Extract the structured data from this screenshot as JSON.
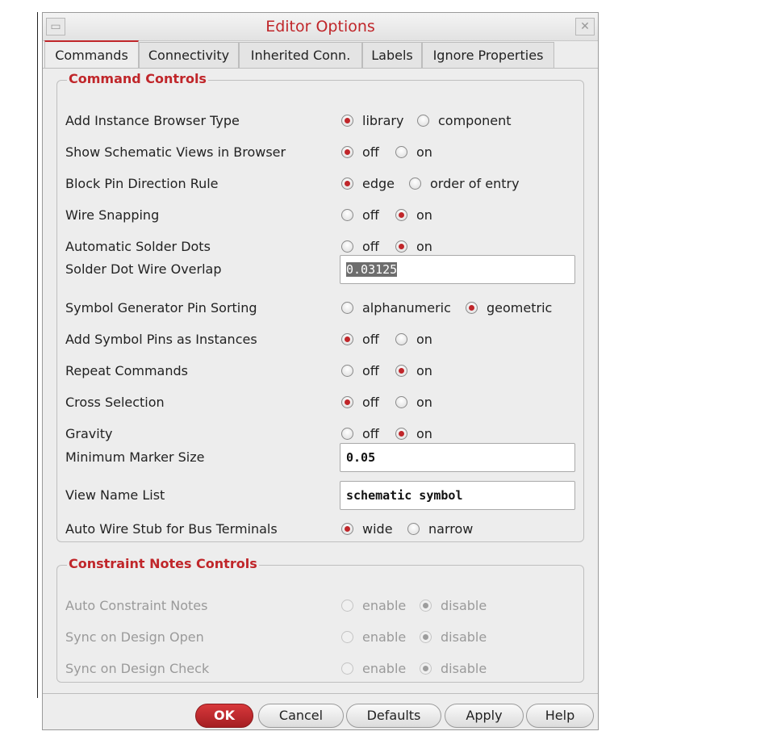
{
  "window": {
    "title": "Editor Options",
    "minimize_glyph": "▭",
    "close_glyph": "✕"
  },
  "tabs": [
    {
      "label": "Commands",
      "active": true
    },
    {
      "label": "Connectivity",
      "active": false
    },
    {
      "label": "Inherited Conn.",
      "active": false
    },
    {
      "label": "Labels",
      "active": false
    },
    {
      "label": "Ignore Properties",
      "active": false
    }
  ],
  "command_controls": {
    "title": "Command Controls",
    "rows": [
      {
        "label": "Add Instance Browser Type",
        "opt1": "library",
        "opt2": "component",
        "selected": 1
      },
      {
        "label": "Show Schematic Views in Browser",
        "opt1": "off",
        "opt2": "on",
        "selected": 1
      },
      {
        "label": "Block Pin Direction Rule",
        "opt1": "edge",
        "opt2": "order of entry",
        "selected": 1
      },
      {
        "label": "Wire Snapping",
        "opt1": "off",
        "opt2": "on",
        "selected": 2
      },
      {
        "label": "Automatic Solder Dots",
        "opt1": "off",
        "opt2": "on",
        "selected": 2
      },
      {
        "label": "Solder Dot Wire Overlap",
        "value": "0.03125"
      },
      {
        "label": "Symbol Generator Pin Sorting",
        "opt1": "alphanumeric",
        "opt2": "geometric",
        "selected": 2
      },
      {
        "label": "Add Symbol Pins as Instances",
        "opt1": "off",
        "opt2": "on",
        "selected": 1
      },
      {
        "label": "Repeat Commands",
        "opt1": "off",
        "opt2": "on",
        "selected": 2
      },
      {
        "label": "Cross Selection",
        "opt1": "off",
        "opt2": "on",
        "selected": 1
      },
      {
        "label": "Gravity",
        "opt1": "off",
        "opt2": "on",
        "selected": 2
      },
      {
        "label": "Minimum Marker Size",
        "value": "0.05"
      },
      {
        "label": "View Name List",
        "value": "schematic symbol"
      },
      {
        "label": "Auto Wire Stub for Bus Terminals",
        "opt1": "wide",
        "opt2": "narrow",
        "selected": 1
      }
    ]
  },
  "constraint_notes": {
    "title": "Constraint Notes Controls",
    "rows": [
      {
        "label": "Auto Constraint Notes",
        "opt1": "enable",
        "opt2": "disable",
        "selected": 2
      },
      {
        "label": "Sync on Design Open",
        "opt1": "enable",
        "opt2": "disable",
        "selected": 2
      },
      {
        "label": "Sync on Design Check",
        "opt1": "enable",
        "opt2": "disable",
        "selected": 2
      }
    ]
  },
  "buttons": {
    "ok": "OK",
    "cancel": "Cancel",
    "defaults": "Defaults",
    "apply": "Apply",
    "help": "Help"
  }
}
